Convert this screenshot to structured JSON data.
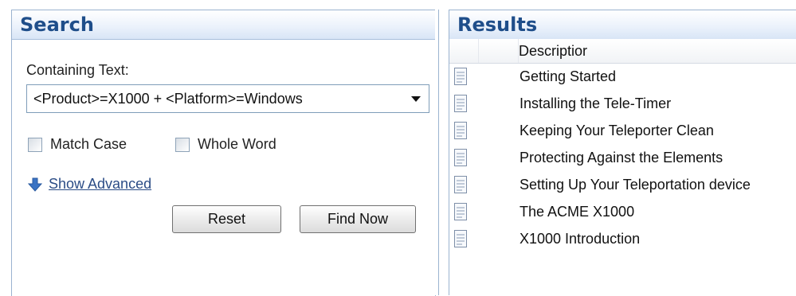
{
  "search": {
    "title": "Search",
    "containing_label": "Containing Text:",
    "query_value": "<Product>=X1000 + <Platform>=Windows",
    "match_case_label": "Match Case",
    "whole_word_label": "Whole Word",
    "show_advanced_label": "Show Advanced",
    "reset_label": "Reset",
    "find_now_label": "Find Now"
  },
  "results": {
    "title": "Results",
    "column_description": "Descriptior",
    "items": [
      {
        "label": "Getting Started"
      },
      {
        "label": "Installing the Tele-Timer"
      },
      {
        "label": "Keeping Your Teleporter Clean"
      },
      {
        "label": "Protecting Against the Elements"
      },
      {
        "label": "Setting Up Your Teleportation device"
      },
      {
        "label": "The ACME X1000"
      },
      {
        "label": "X1000 Introduction"
      }
    ]
  },
  "icons": {
    "arrow": "blue-down-arrow-icon",
    "document": "document-icon"
  },
  "colors": {
    "header_text": "#1f4e8a",
    "border": "#9bb3d0",
    "link": "#2b4c86"
  }
}
